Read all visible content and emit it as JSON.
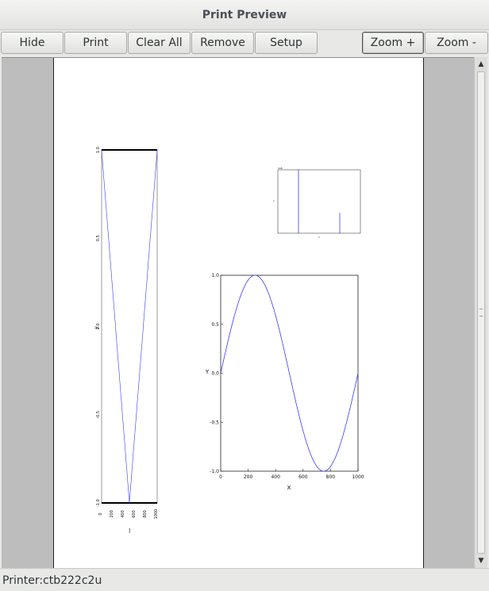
{
  "window": {
    "title": "Print Preview"
  },
  "toolbar": {
    "hide": "Hide",
    "print": "Print",
    "clear_all": "Clear All",
    "remove": "Remove",
    "setup": "Setup",
    "zoom_in": "Zoom +",
    "zoom_out": "Zoom -"
  },
  "status": {
    "printer": "Printer:ctb222c2u"
  },
  "colors": {
    "line": "#3a3aff",
    "page": "#ffffff",
    "margin": "#bdbdbd"
  },
  "scrollbar": {
    "up_icon": "arrow-up-icon",
    "down_icon": "arrow-down-icon"
  },
  "chart_data": [
    {
      "type": "line",
      "x": [
        0,
        100,
        200,
        300,
        400,
        500,
        600,
        700,
        800,
        900,
        1000
      ],
      "y": [
        1.0,
        0.81,
        0.31,
        -0.31,
        -0.81,
        -1.0,
        -0.81,
        -0.31,
        0.31,
        0.81,
        1.0
      ],
      "xlim": [
        0,
        1000
      ],
      "ylim": [
        -1.0,
        1.0
      ],
      "xticks": [
        "0",
        "200",
        "400",
        "600",
        "800",
        "1000"
      ],
      "yticks": [
        "1.0",
        "0.5",
        "0.0",
        "-0.5",
        "-1.0"
      ],
      "xlabel": "",
      "ylabel": "y",
      "note": "rotated on page"
    },
    {
      "type": "bar",
      "x": [
        250,
        750
      ],
      "values": [
        1.0,
        0.32
      ],
      "xlim": [
        0,
        1000
      ],
      "ylim": [
        0,
        1.0
      ],
      "xlabel": "x",
      "ylabel": "y"
    },
    {
      "type": "line",
      "x": [
        0,
        100,
        200,
        250,
        300,
        400,
        500,
        600,
        700,
        750,
        800,
        900,
        1000
      ],
      "y": [
        0.0,
        0.59,
        0.95,
        1.0,
        0.95,
        0.59,
        0.0,
        -0.59,
        -0.95,
        -1.0,
        -0.95,
        -0.59,
        0.0
      ],
      "xlim": [
        0,
        1000
      ],
      "ylim": [
        -1.0,
        1.0
      ],
      "xticks": [
        "0",
        "200",
        "400",
        "600",
        "800",
        "1000"
      ],
      "yticks": [
        "1.0",
        "0.5",
        "0.0",
        "-0.5",
        "-1.0"
      ],
      "xlabel": "X",
      "ylabel": "Y"
    }
  ]
}
